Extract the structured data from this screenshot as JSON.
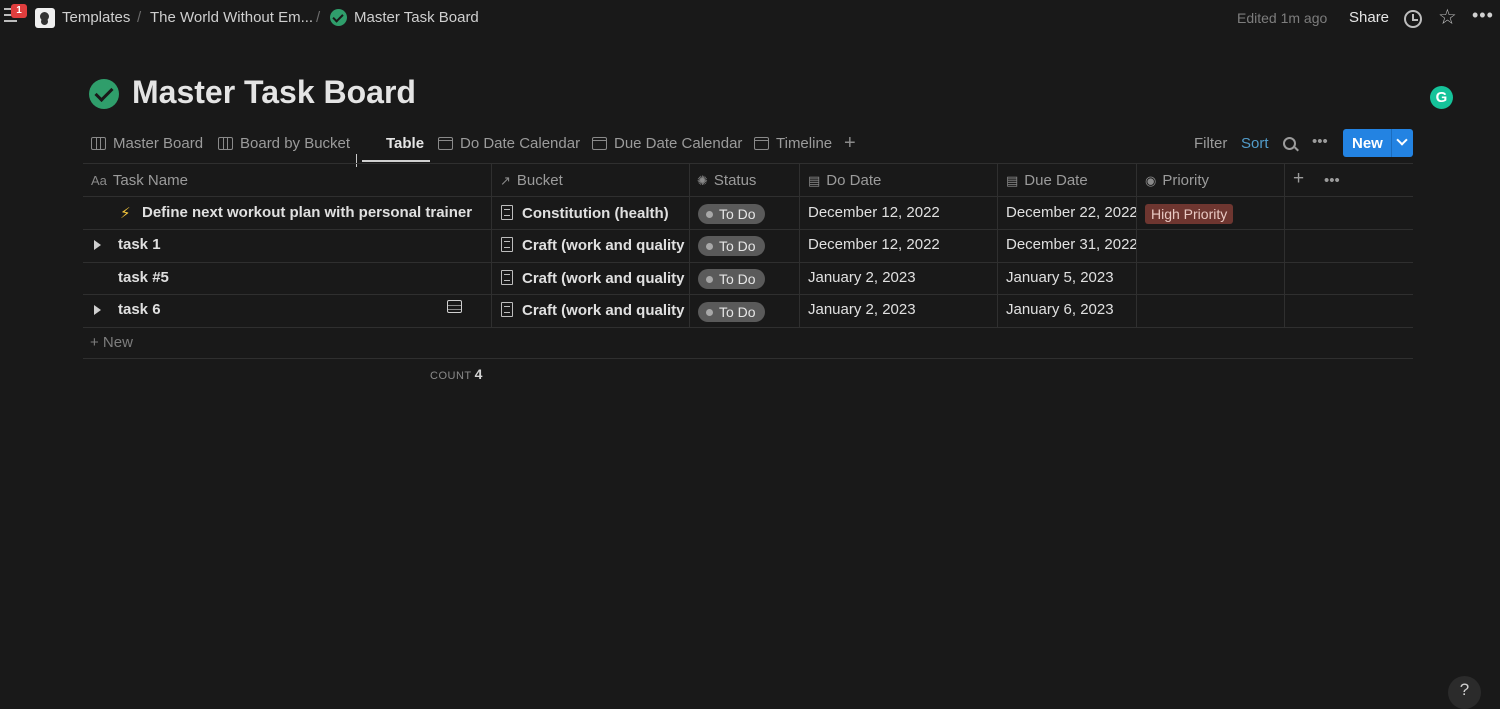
{
  "topbar": {
    "notification_count": "1",
    "breadcrumbs": [
      "Templates",
      "The World Without Em...",
      "Master Task Board"
    ],
    "edited": "Edited 1m ago",
    "share": "Share"
  },
  "page": {
    "title": "Master Task Board",
    "grammarly": "G"
  },
  "views": {
    "tabs": [
      {
        "label": "Master Board",
        "icon": "board-icon"
      },
      {
        "label": "Board by Bucket",
        "icon": "board-icon"
      },
      {
        "label": "Table",
        "icon": "table-icon",
        "active": true
      },
      {
        "label": "Do Date Calendar",
        "icon": "calendar-icon"
      },
      {
        "label": "Due Date Calendar",
        "icon": "calendar-icon"
      },
      {
        "label": "Timeline",
        "icon": "timeline-icon"
      }
    ],
    "add": "+",
    "filter": "Filter",
    "sort": "Sort",
    "new_button": "New"
  },
  "table": {
    "columns": [
      {
        "label": "Task Name",
        "icon": "Aa"
      },
      {
        "label": "Bucket",
        "icon": "↗"
      },
      {
        "label": "Status",
        "icon": "✺"
      },
      {
        "label": "Do Date",
        "icon": "▤"
      },
      {
        "label": "Due Date",
        "icon": "▤"
      },
      {
        "label": "Priority",
        "icon": "◉"
      }
    ],
    "rows": [
      {
        "name": "Define next workout plan with personal trainer",
        "prefix": "⚡",
        "bucket": "Constitution (health)",
        "status": "To Do",
        "do_date": "December 12, 2022",
        "due_date": "December 22, 2022",
        "priority": "High Priority"
      },
      {
        "name": "task 1",
        "bucket": "Craft (work and quality leisure)",
        "status": "To Do",
        "do_date": "December 12, 2022",
        "due_date": "December 31, 2022",
        "priority": ""
      },
      {
        "name": "task #5",
        "bucket": "Craft (work and quality leisure)",
        "status": "To Do",
        "do_date": "January 2, 2023",
        "due_date": "January 5, 2023",
        "priority": ""
      },
      {
        "name": "task 6",
        "bucket": "Craft (work and quality leisure)",
        "status": "To Do",
        "do_date": "January 2, 2023",
        "due_date": "January 6, 2023",
        "priority": ""
      }
    ],
    "add_row": "+ New",
    "count_label": "COUNT",
    "count_value": "4"
  },
  "colors": {
    "background": "#191919",
    "accent": "#2383e2",
    "sort": "#529cca",
    "check": "#2f9e6b",
    "high_priority": "#6e3630"
  },
  "help": "?"
}
